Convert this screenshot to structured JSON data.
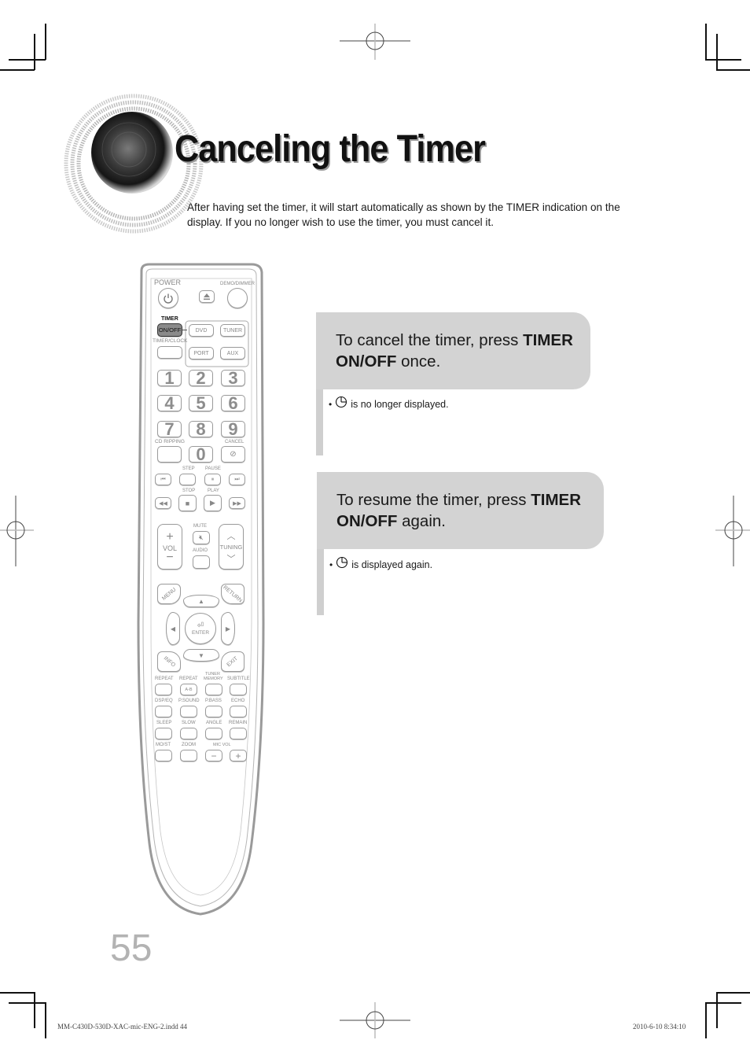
{
  "header": {
    "title": "Canceling the Timer",
    "intro": "After having set the timer, it will start automatically as shown by the TIMER indication on the display. If you no longer wish to use the timer, you must cancel it."
  },
  "steps": [
    {
      "instruction_prefix": "To cancel the timer, press ",
      "instruction_bold": "TIMER ON/OFF",
      "instruction_suffix": " once.",
      "note_icon": "timer-clock-icon",
      "note_text": "is no longer displayed."
    },
    {
      "instruction_prefix": "To resume the timer, press ",
      "instruction_bold": "TIMER ON/OFF",
      "instruction_suffix": " again.",
      "note_icon": "timer-clock-icon",
      "note_text": "is displayed again."
    }
  ],
  "remote": {
    "labels": {
      "power": "POWER",
      "demo_dimmer": "DEMO/DIMMER",
      "timer": "TIMER",
      "on_off": "ON/OFF",
      "timer_clock": "TIMER/CLOCK",
      "dvd": "DVD",
      "tuner": "TUNER",
      "port": "PORT",
      "aux": "AUX",
      "cd_ripping": "CD RIPPING",
      "cancel": "CANCEL",
      "step": "STEP",
      "pause": "PAUSE",
      "stop": "STOP",
      "play": "PLAY",
      "mute": "MUTE",
      "audio": "AUDIO",
      "vol": "VOL",
      "tuning": "TUNING",
      "menu": "MENU",
      "return": "RETURN",
      "enter": "ENTER",
      "info": "INFO",
      "exit": "EXIT",
      "repeat": "REPEAT",
      "repeat_ab": "REPEAT",
      "ab": "A-B",
      "tuner_memory_1": "TUNER",
      "tuner_memory_2": "MEMORY",
      "subtitle": "SUBTITLE",
      "dsp_eq": "DSP/EQ",
      "p_sound": "P.SOUND",
      "p_bass": "P.BASS",
      "echo": "ECHO",
      "sleep": "SLEEP",
      "slow": "SLOW",
      "angle": "ANGLE",
      "remain": "REMAIN",
      "mo_st": "MO/ST",
      "zoom": "ZOOM",
      "mic_vol": "MIC VOL"
    },
    "numbers": [
      "1",
      "2",
      "3",
      "4",
      "5",
      "6",
      "7",
      "8",
      "9",
      "0"
    ]
  },
  "footer": {
    "page_number": "55",
    "slug_file": "MM-C430D-530D-XAC-mic-ENG-2.indd   44",
    "slug_date": "2010-6-10   8:34:10"
  }
}
